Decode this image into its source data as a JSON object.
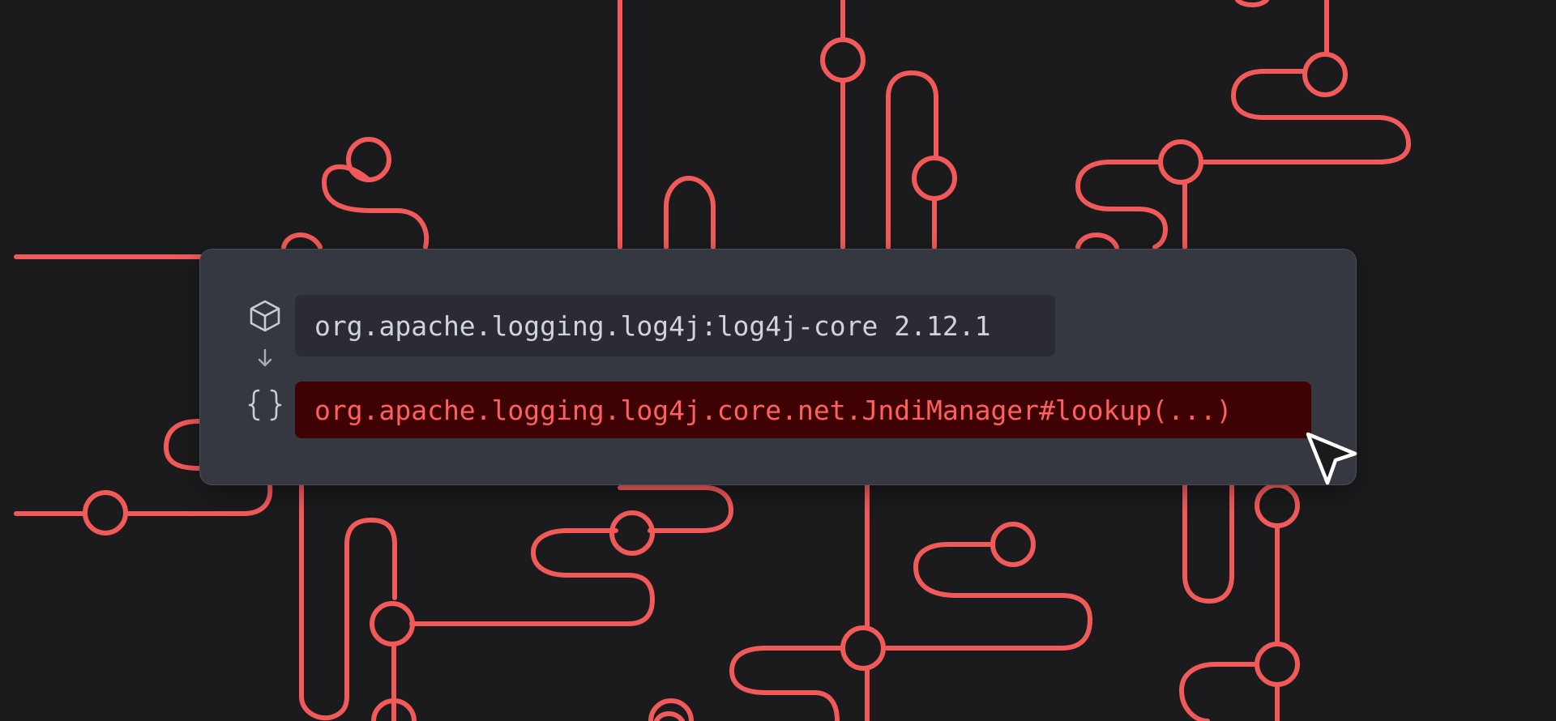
{
  "colors": {
    "background": "#1b1a1d",
    "line_accent": "#f25a5a",
    "card_background": "#363841",
    "package_pill_background": "#2b2c33",
    "package_text": "#d0d3dc",
    "method_pill_background": "#3e0204",
    "method_text": "#ff5f5f"
  },
  "dependency": {
    "icon": "package-cube-icon",
    "label": "org.apache.logging.log4j:log4j-core 2.12.1"
  },
  "connector": {
    "icon": "arrow-down-icon"
  },
  "method": {
    "icon": "curly-braces-icon",
    "label": "org.apache.logging.log4j.core.net.JndiManager#lookup(...)",
    "state": "highlighted"
  },
  "pointer": {
    "icon": "mouse-pointer-icon"
  }
}
